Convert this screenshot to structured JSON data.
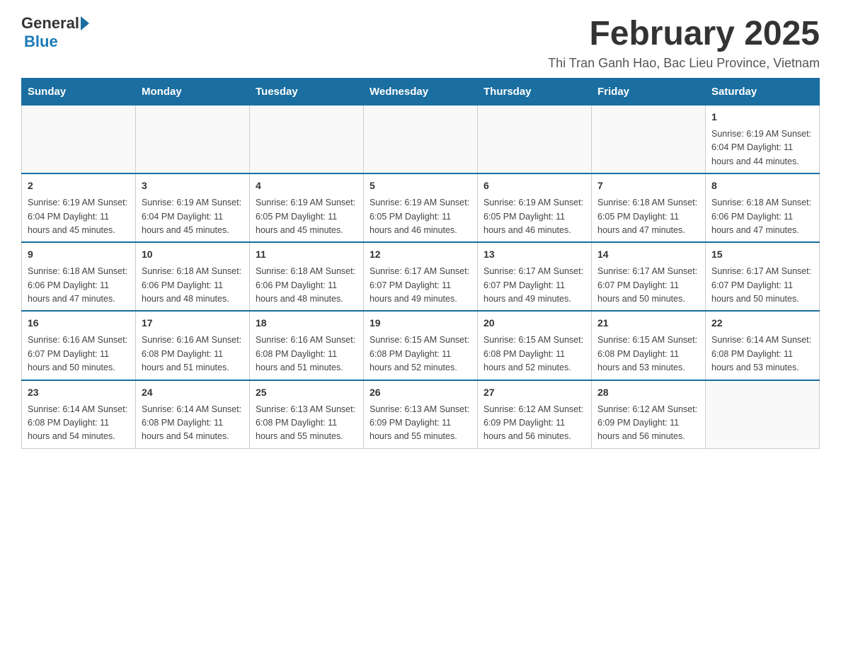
{
  "logo": {
    "general": "General",
    "blue": "Blue"
  },
  "title": "February 2025",
  "subtitle": "Thi Tran Ganh Hao, Bac Lieu Province, Vietnam",
  "headers": [
    "Sunday",
    "Monday",
    "Tuesday",
    "Wednesday",
    "Thursday",
    "Friday",
    "Saturday"
  ],
  "weeks": [
    [
      {
        "day": "",
        "info": ""
      },
      {
        "day": "",
        "info": ""
      },
      {
        "day": "",
        "info": ""
      },
      {
        "day": "",
        "info": ""
      },
      {
        "day": "",
        "info": ""
      },
      {
        "day": "",
        "info": ""
      },
      {
        "day": "1",
        "info": "Sunrise: 6:19 AM\nSunset: 6:04 PM\nDaylight: 11 hours\nand 44 minutes."
      }
    ],
    [
      {
        "day": "2",
        "info": "Sunrise: 6:19 AM\nSunset: 6:04 PM\nDaylight: 11 hours\nand 45 minutes."
      },
      {
        "day": "3",
        "info": "Sunrise: 6:19 AM\nSunset: 6:04 PM\nDaylight: 11 hours\nand 45 minutes."
      },
      {
        "day": "4",
        "info": "Sunrise: 6:19 AM\nSunset: 6:05 PM\nDaylight: 11 hours\nand 45 minutes."
      },
      {
        "day": "5",
        "info": "Sunrise: 6:19 AM\nSunset: 6:05 PM\nDaylight: 11 hours\nand 46 minutes."
      },
      {
        "day": "6",
        "info": "Sunrise: 6:19 AM\nSunset: 6:05 PM\nDaylight: 11 hours\nand 46 minutes."
      },
      {
        "day": "7",
        "info": "Sunrise: 6:18 AM\nSunset: 6:05 PM\nDaylight: 11 hours\nand 47 minutes."
      },
      {
        "day": "8",
        "info": "Sunrise: 6:18 AM\nSunset: 6:06 PM\nDaylight: 11 hours\nand 47 minutes."
      }
    ],
    [
      {
        "day": "9",
        "info": "Sunrise: 6:18 AM\nSunset: 6:06 PM\nDaylight: 11 hours\nand 47 minutes."
      },
      {
        "day": "10",
        "info": "Sunrise: 6:18 AM\nSunset: 6:06 PM\nDaylight: 11 hours\nand 48 minutes."
      },
      {
        "day": "11",
        "info": "Sunrise: 6:18 AM\nSunset: 6:06 PM\nDaylight: 11 hours\nand 48 minutes."
      },
      {
        "day": "12",
        "info": "Sunrise: 6:17 AM\nSunset: 6:07 PM\nDaylight: 11 hours\nand 49 minutes."
      },
      {
        "day": "13",
        "info": "Sunrise: 6:17 AM\nSunset: 6:07 PM\nDaylight: 11 hours\nand 49 minutes."
      },
      {
        "day": "14",
        "info": "Sunrise: 6:17 AM\nSunset: 6:07 PM\nDaylight: 11 hours\nand 50 minutes."
      },
      {
        "day": "15",
        "info": "Sunrise: 6:17 AM\nSunset: 6:07 PM\nDaylight: 11 hours\nand 50 minutes."
      }
    ],
    [
      {
        "day": "16",
        "info": "Sunrise: 6:16 AM\nSunset: 6:07 PM\nDaylight: 11 hours\nand 50 minutes."
      },
      {
        "day": "17",
        "info": "Sunrise: 6:16 AM\nSunset: 6:08 PM\nDaylight: 11 hours\nand 51 minutes."
      },
      {
        "day": "18",
        "info": "Sunrise: 6:16 AM\nSunset: 6:08 PM\nDaylight: 11 hours\nand 51 minutes."
      },
      {
        "day": "19",
        "info": "Sunrise: 6:15 AM\nSunset: 6:08 PM\nDaylight: 11 hours\nand 52 minutes."
      },
      {
        "day": "20",
        "info": "Sunrise: 6:15 AM\nSunset: 6:08 PM\nDaylight: 11 hours\nand 52 minutes."
      },
      {
        "day": "21",
        "info": "Sunrise: 6:15 AM\nSunset: 6:08 PM\nDaylight: 11 hours\nand 53 minutes."
      },
      {
        "day": "22",
        "info": "Sunrise: 6:14 AM\nSunset: 6:08 PM\nDaylight: 11 hours\nand 53 minutes."
      }
    ],
    [
      {
        "day": "23",
        "info": "Sunrise: 6:14 AM\nSunset: 6:08 PM\nDaylight: 11 hours\nand 54 minutes."
      },
      {
        "day": "24",
        "info": "Sunrise: 6:14 AM\nSunset: 6:08 PM\nDaylight: 11 hours\nand 54 minutes."
      },
      {
        "day": "25",
        "info": "Sunrise: 6:13 AM\nSunset: 6:08 PM\nDaylight: 11 hours\nand 55 minutes."
      },
      {
        "day": "26",
        "info": "Sunrise: 6:13 AM\nSunset: 6:09 PM\nDaylight: 11 hours\nand 55 minutes."
      },
      {
        "day": "27",
        "info": "Sunrise: 6:12 AM\nSunset: 6:09 PM\nDaylight: 11 hours\nand 56 minutes."
      },
      {
        "day": "28",
        "info": "Sunrise: 6:12 AM\nSunset: 6:09 PM\nDaylight: 11 hours\nand 56 minutes."
      },
      {
        "day": "",
        "info": ""
      }
    ]
  ]
}
